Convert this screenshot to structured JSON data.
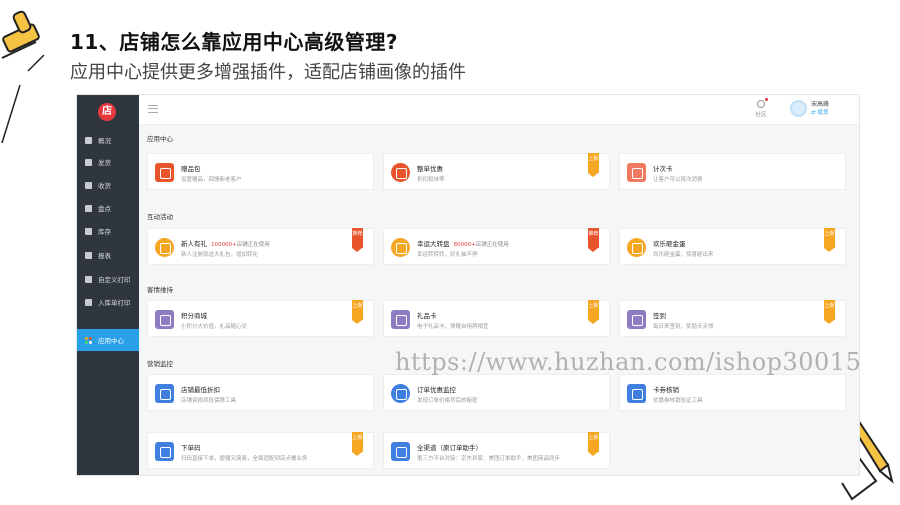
{
  "slide": {
    "title": "11、店铺怎么靠应用中心高级管理?",
    "subtitle": "应用中心提供更多增强插件，适配店铺画像的插件"
  },
  "app": {
    "logo_text": "店",
    "sidebar": {
      "items": [
        {
          "label": "概况",
          "icon": "home-icon"
        },
        {
          "label": "发货",
          "icon": "truck-icon"
        },
        {
          "label": "收货",
          "icon": "inbox-icon"
        },
        {
          "label": "盘点",
          "icon": "clipboard-icon"
        },
        {
          "label": "库存",
          "icon": "box-icon"
        },
        {
          "label": "报表",
          "icon": "chart-icon"
        },
        {
          "label": "自定义打印",
          "icon": "printer-icon"
        },
        {
          "label": "入库单打印",
          "icon": "printer-icon"
        },
        {
          "label": "应用中心",
          "icon": "apps-icon",
          "active": true
        }
      ]
    },
    "topbar": {
      "community_label": "社区",
      "user_name": "宋高峰",
      "switch_label": "⇄ 增货"
    },
    "sections": [
      {
        "title": "应用中心",
        "cards": [
          {
            "name": "赠品包",
            "desc": "设置赠品，回馈新老客户",
            "icon": "gift-icon",
            "color": "#e8552c",
            "tag": ""
          },
          {
            "name": "整单优惠",
            "desc": "折扣和抹零",
            "icon": "discount-icon",
            "color": "#e8552c",
            "tag": "上新"
          },
          {
            "name": "计次卡",
            "desc": "让客户可以按次消费",
            "icon": "card-icon",
            "color": "#f07a60",
            "tag": ""
          }
        ]
      },
      {
        "title": "互动活动",
        "cards": [
          {
            "name": "新人有礼",
            "highlight": "100000+",
            "note": "店铺正在使用",
            "desc": "新人注册就送大礼包，增加转化",
            "icon": "newbie-icon",
            "color": "#f5a623",
            "tag": "推荐",
            "round": true
          },
          {
            "name": "幸运大转盘",
            "highlight": "80000+",
            "note": "店铺正在使用",
            "desc": "幸运转转转，好礼抽不停",
            "icon": "wheel-icon",
            "color": "#f5a623",
            "tag": "推荐",
            "round": true
          },
          {
            "name": "欢乐砸金蛋",
            "desc": "欢乐砸金蛋，惊喜砸出来",
            "icon": "egg-icon",
            "color": "#f5a623",
            "tag": "上新",
            "round": true
          }
        ]
      },
      {
        "title": "客情维持",
        "cards": [
          {
            "name": "积分商城",
            "desc": "小积分大价值，礼品随心兑",
            "icon": "coins-icon",
            "color": "#8e7cc3",
            "tag": "上新"
          },
          {
            "name": "礼品卡",
            "desc": "电子礼品卡，馈赠自用两相宜",
            "icon": "giftcard-icon",
            "color": "#8e7cc3",
            "tag": "上新"
          },
          {
            "name": "签到",
            "desc": "每日来签到，奖励天天领",
            "icon": "checkin-icon",
            "color": "#8e7cc3",
            "tag": "上新"
          }
        ]
      },
      {
        "title": "营销监控",
        "cards": [
          {
            "name": "店铺最低折扣",
            "desc": "店铺资损风险保障工具",
            "icon": "price-tag-icon",
            "color": "#3f7fe0",
            "tag": ""
          },
          {
            "name": "订单优惠监控",
            "desc": "发现订单价格背后的秘密",
            "icon": "monitor-icon",
            "color": "#3f7fe0",
            "tag": ""
          },
          {
            "name": "卡券核销",
            "desc": "优惠券核销验证工具",
            "icon": "shield-check-icon",
            "color": "#3f7fe0",
            "tag": ""
          },
          {
            "name": "下单码",
            "desc": "扫码直接下单，便捷又简易，全面适配到店点餐业务",
            "icon": "qrcode-icon",
            "color": "#3f7fe0",
            "tag": "上新"
          },
          {
            "name": "全渠道（原订单助手）",
            "desc": "第三方平台对接：京东到家、美团订单助手、美团商品同步",
            "icon": "document-icon",
            "color": "#3f7fe0",
            "tag": "上新"
          }
        ]
      }
    ]
  },
  "watermark": "https://www.huzhan.com/ishop30015",
  "colors": {
    "sidebar_bg": "#303640",
    "active_blue": "#28a0e8",
    "tag_new": "#f5a623",
    "tag_hot": "#e8552c"
  }
}
